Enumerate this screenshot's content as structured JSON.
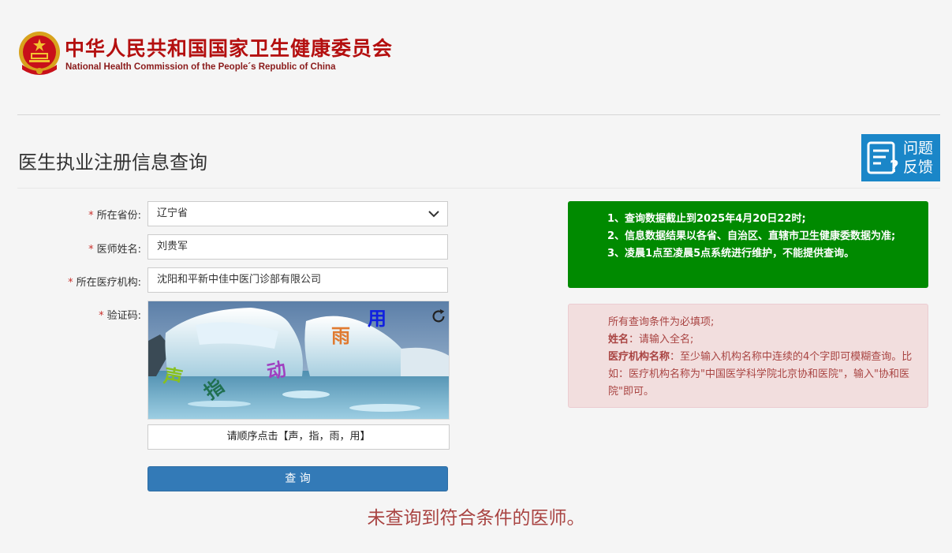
{
  "header": {
    "org_name_cn": "中华人民共和国国家卫生健康委员会",
    "org_name_en": "National Health Commission of the People´s Republic of China"
  },
  "page": {
    "title": "医生执业注册信息查询",
    "feedback_line1": "问题",
    "feedback_line2": "反馈"
  },
  "form": {
    "required_mark": "*",
    "province": {
      "label": "所在省份:",
      "value": "辽宁省"
    },
    "doctor_name": {
      "label": "医师姓名:",
      "value": "刘贵军"
    },
    "institution": {
      "label": "所在医疗机构:",
      "value": "沈阳和平新中佳中医门诊部有限公司"
    },
    "captcha": {
      "label": "验证码:",
      "chars": [
        "用",
        "雨",
        "动",
        "声",
        "指"
      ],
      "colors": [
        "#1020e0",
        "#e07a30",
        "#a040c0",
        "#88c020",
        "#207050"
      ],
      "hint": "请顺序点击【声，指，雨，用】"
    },
    "submit_label": "查 询"
  },
  "result_message": "未查询到符合条件的医师。",
  "notices": {
    "green": [
      "1、查询数据截止到2025年4月20日22时;",
      "2、信息数据结果以各省、自治区、直辖市卫生健康委数据为准;",
      "3、凌晨1点至凌晨5点系统进行维护，不能提供查询。"
    ],
    "red": {
      "line1": "所有查询条件为必填项;",
      "name_label": "姓名",
      "name_text": "：请输入全名;",
      "inst_label": "医疗机构名称",
      "inst_text": "：至少输入机构名称中连续的4个字即可模糊查询。比如：医疗机构名称为\"中国医学科学院北京协和医院\"，输入\"协和医院\"即可。"
    }
  },
  "icons": {
    "emblem": "national-emblem-icon",
    "select": "chevron-down-icon",
    "refresh": "refresh-icon",
    "feedback": "feedback-icon"
  },
  "colors": {
    "org_red": "#b40f0f",
    "primary": "#337ab7",
    "notice_green": "#008a00",
    "feedback_blue": "#1a86c8",
    "error_red": "#a94442"
  }
}
